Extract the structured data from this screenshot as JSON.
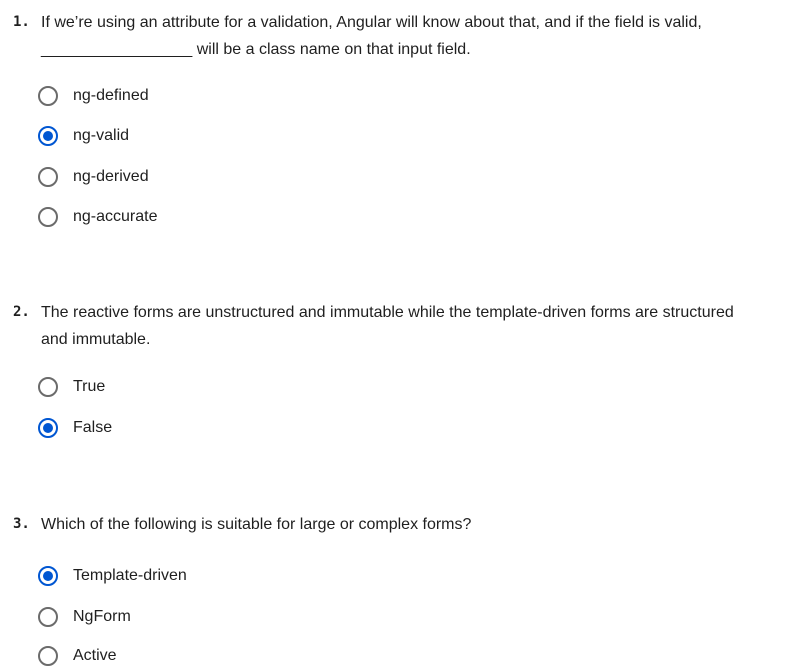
{
  "questions": [
    {
      "number": "1.",
      "line1": "If we’re using an attribute for a validation, Angular will know about that, and if the field is valid,",
      "line2": "_________________ will be a class name on that input field.",
      "options": [
        {
          "label": "ng-defined",
          "selected": false
        },
        {
          "label": "ng-valid",
          "selected": true
        },
        {
          "label": "ng-derived",
          "selected": false
        },
        {
          "label": "ng-accurate",
          "selected": false
        }
      ]
    },
    {
      "number": "2.",
      "line1": "The reactive forms are unstructured and immutable while the template-driven forms are structured",
      "line2": "and immutable.",
      "options": [
        {
          "label": "True",
          "selected": false
        },
        {
          "label": "False",
          "selected": true
        }
      ]
    },
    {
      "number": "3.",
      "line1": "Which of the following is suitable for large or complex forms?",
      "line2": "",
      "options": [
        {
          "label": "Template-driven",
          "selected": true
        },
        {
          "label": "NgForm",
          "selected": false
        },
        {
          "label": "Active",
          "selected": false
        }
      ]
    }
  ]
}
